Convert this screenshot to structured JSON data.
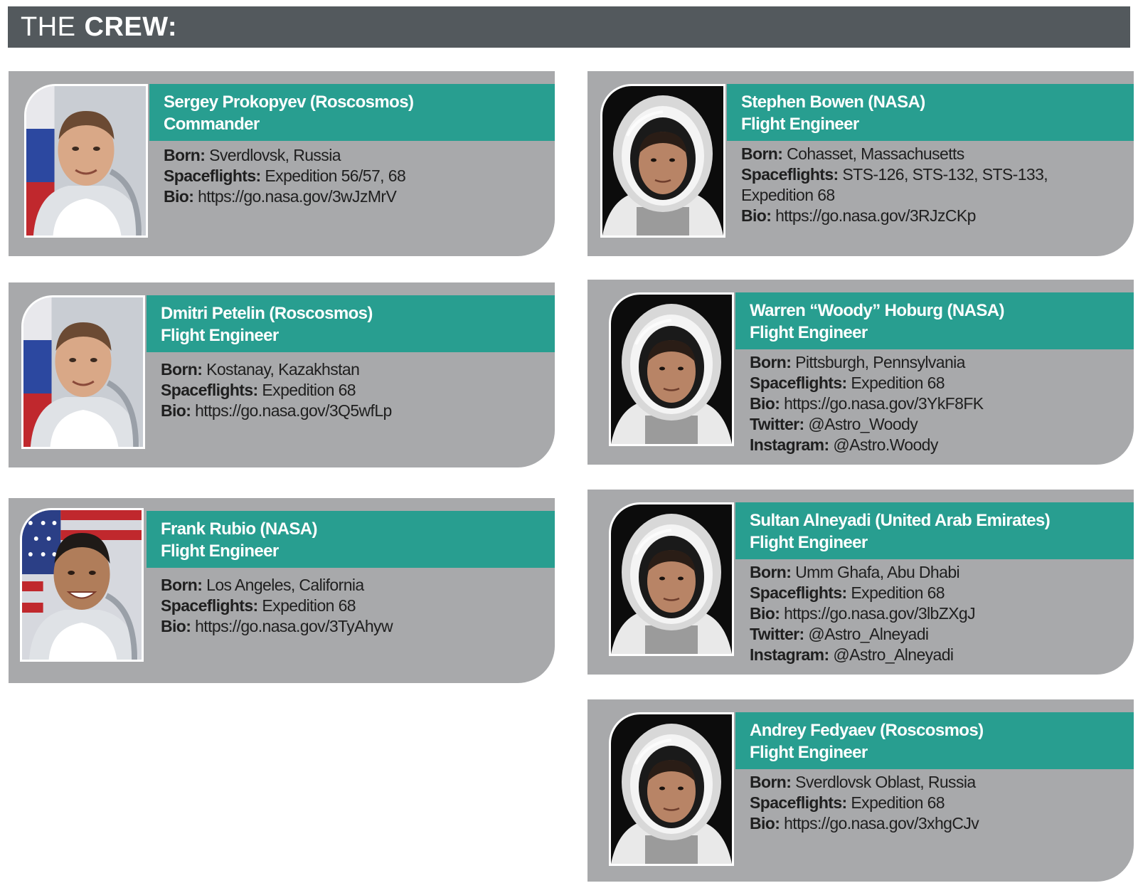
{
  "header": {
    "title_light": "THE",
    "title_bold": "CREW:"
  },
  "labels": {
    "born": "Born:",
    "spaceflights": "Spaceflights:",
    "bio": "Bio:",
    "twitter": "Twitter:",
    "instagram": "Instagram:"
  },
  "crew": [
    {
      "name": "Sergey Prokopyev (Roscosmos)",
      "role": "Commander",
      "born": "Sverdlovsk, Russia",
      "spaceflights_lines": [
        "Expedition 56/57, 68"
      ],
      "bio": "https://go.nasa.gov/3wJzMrV"
    },
    {
      "name": "Stephen Bowen (NASA)",
      "role": "Flight Engineer",
      "born": "Cohasset, Massachusetts",
      "spaceflights_lines": [
        "STS-126, STS-132, STS-133,",
        "Expedition 68"
      ],
      "bio": "https://go.nasa.gov/3RJzCKp"
    },
    {
      "name": "Dmitri Petelin (Roscosmos)",
      "role": "Flight Engineer",
      "born": "Kostanay, Kazakhstan",
      "spaceflights_lines": [
        "Expedition 68"
      ],
      "bio": "https://go.nasa.gov/3Q5wfLp"
    },
    {
      "name": "Warren “Woody” Hoburg (NASA)",
      "role": "Flight Engineer",
      "born": "Pittsburgh, Pennsylvania",
      "spaceflights_lines": [
        "Expedition 68"
      ],
      "bio": "https://go.nasa.gov/3YkF8FK",
      "twitter": "@Astro_Woody",
      "instagram": "@Astro.Woody"
    },
    {
      "name": "Frank Rubio (NASA)",
      "role": "Flight Engineer",
      "born": "Los Angeles, California",
      "spaceflights_lines": [
        "Expedition 68"
      ],
      "bio": "https://go.nasa.gov/3TyAhyw"
    },
    {
      "name": "Sultan Alneyadi (United Arab Emirates)",
      "role": "Flight Engineer",
      "born": "Umm Ghafa, Abu Dhabi",
      "spaceflights_lines": [
        "Expedition 68"
      ],
      "bio": "https://go.nasa.gov/3lbZXgJ",
      "twitter": "@Astro_Alneyadi",
      "instagram": "@Astro_Alneyadi"
    },
    {
      "name": "Andrey Fedyaev (Roscosmos)",
      "role": "Flight Engineer",
      "born": "Sverdlovsk Oblast, Russia",
      "spaceflights_lines": [
        "Expedition 68"
      ],
      "bio": "https://go.nasa.gov/3xhgCJv"
    }
  ]
}
